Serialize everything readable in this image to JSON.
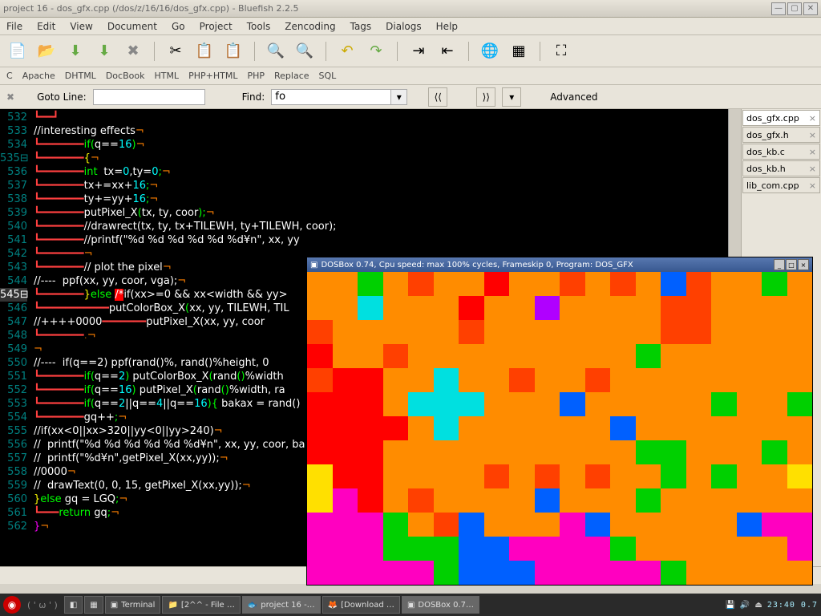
{
  "title": "project 16 - dos_gfx.cpp (/dos/z/16/16/dos_gfx.cpp) - Bluefish 2.2.5",
  "menu": [
    "File",
    "Edit",
    "View",
    "Document",
    "Go",
    "Project",
    "Tools",
    "Zencoding",
    "Tags",
    "Dialogs",
    "Help"
  ],
  "lang": [
    "C",
    "Apache",
    "DHTML",
    "DocBook",
    "HTML",
    "PHP+HTML",
    "PHP",
    "Replace",
    "SQL"
  ],
  "goto_label": "Goto Line:",
  "find_label": "Find:",
  "find_value": "fo",
  "advanced": "Advanced",
  "tabs": [
    {
      "label": "dos_gfx.cpp",
      "active": true
    },
    {
      "label": "dos_gfx.h",
      "active": false
    },
    {
      "label": "dos_kb.c",
      "active": false
    },
    {
      "label": "dos_kb.h",
      "active": false
    },
    {
      "label": "lib_com.cpp",
      "active": false
    }
  ],
  "lines": [
    532,
    533,
    534,
    535,
    536,
    537,
    538,
    539,
    540,
    541,
    542,
    543,
    544,
    545,
    546,
    547,
    548,
    549,
    550,
    551,
    552,
    553,
    554,
    555,
    556,
    557,
    558,
    559,
    560,
    561,
    562
  ],
  "highlight_line": 545,
  "dosbox_title": "DOSBox 0.74, Cpu speed: max 100% cycles, Frameskip  0, Program:   DOS_GFX",
  "taskbar": {
    "face": "( ' ω ' )",
    "items": [
      "Terminal",
      "[2^^ - File …",
      "project 16 -…",
      "[Download …",
      "DOSBox 0.7…"
    ],
    "clock": "23:40  0.7"
  },
  "pixel_colors": [
    "#ff8c00",
    "#ff8c00",
    "#00d000",
    "#ff8c00",
    "#ff4000",
    "#ff8c00",
    "#ff8c00",
    "#ff0000",
    "#ff8c00",
    "#ff8c00",
    "#ff4000",
    "#ff8c00",
    "#ff4000",
    "#ff8c00",
    "#0060ff",
    "#ff4000",
    "#ff8c00",
    "#ff8c00",
    "#00d000",
    "#ff8c00",
    "#ff8c00",
    "#ff8c00",
    "#00e0e0",
    "#ff8c00",
    "#ff8c00",
    "#ff8c00",
    "#ff0000",
    "#ff8c00",
    "#ff8c00",
    "#b000ff",
    "#ff8c00",
    "#ff8c00",
    "#ff8c00",
    "#ff8c00",
    "#ff4000",
    "#ff4000",
    "#ff8c00",
    "#ff8c00",
    "#ff8c00",
    "#ff8c00",
    "#ff4000",
    "#ff8c00",
    "#ff8c00",
    "#ff8c00",
    "#ff8c00",
    "#ff8c00",
    "#ff4000",
    "#ff8c00",
    "#ff8c00",
    "#ff8c00",
    "#ff8c00",
    "#ff8c00",
    "#ff8c00",
    "#ff8c00",
    "#ff4000",
    "#ff4000",
    "#ff8c00",
    "#ff8c00",
    "#ff8c00",
    "#ff8c00",
    "#ff0000",
    "#ff8c00",
    "#ff8c00",
    "#ff4000",
    "#ff8c00",
    "#ff8c00",
    "#ff8c00",
    "#ff8c00",
    "#ff8c00",
    "#ff8c00",
    "#ff8c00",
    "#ff8c00",
    "#ff8c00",
    "#00d000",
    "#ff8c00",
    "#ff8c00",
    "#ff8c00",
    "#ff8c00",
    "#ff8c00",
    "#ff8c00",
    "#ff4000",
    "#ff0000",
    "#ff0000",
    "#ff8c00",
    "#ff8c00",
    "#00e0e0",
    "#ff8c00",
    "#ff8c00",
    "#ff4000",
    "#ff8c00",
    "#ff8c00",
    "#ff4000",
    "#ff8c00",
    "#ff8c00",
    "#ff8c00",
    "#ff8c00",
    "#ff8c00",
    "#ff8c00",
    "#ff8c00",
    "#ff8c00",
    "#ff0000",
    "#ff0000",
    "#ff0000",
    "#ff8c00",
    "#00e0e0",
    "#00e0e0",
    "#00e0e0",
    "#ff8c00",
    "#ff8c00",
    "#ff8c00",
    "#0060ff",
    "#ff8c00",
    "#ff8c00",
    "#ff8c00",
    "#ff8c00",
    "#ff8c00",
    "#00d000",
    "#ff8c00",
    "#ff8c00",
    "#00d000",
    "#ff0000",
    "#ff0000",
    "#ff0000",
    "#ff0000",
    "#ff8c00",
    "#00e0e0",
    "#ff8c00",
    "#ff8c00",
    "#ff8c00",
    "#ff8c00",
    "#ff8c00",
    "#ff8c00",
    "#0060ff",
    "#ff8c00",
    "#ff8c00",
    "#ff8c00",
    "#ff8c00",
    "#ff8c00",
    "#ff8c00",
    "#ff8c00",
    "#ff0000",
    "#ff0000",
    "#ff0000",
    "#ff8c00",
    "#ff8c00",
    "#ff8c00",
    "#ff8c00",
    "#ff8c00",
    "#ff8c00",
    "#ff8c00",
    "#ff8c00",
    "#ff8c00",
    "#ff8c00",
    "#00d000",
    "#00d000",
    "#ff8c00",
    "#ff8c00",
    "#ff8c00",
    "#00d000",
    "#ff8c00",
    "#ffe000",
    "#ff0000",
    "#ff0000",
    "#ff8c00",
    "#ff8c00",
    "#ff8c00",
    "#ff8c00",
    "#ff4000",
    "#ff8c00",
    "#ff4000",
    "#ff8c00",
    "#ff4000",
    "#ff8c00",
    "#ff8c00",
    "#00d000",
    "#ff8c00",
    "#00d000",
    "#ff8c00",
    "#ff8c00",
    "#ffe000",
    "#ffe000",
    "#ff00c0",
    "#ff0000",
    "#ff8c00",
    "#ff4000",
    "#ff8c00",
    "#ff8c00",
    "#ff8c00",
    "#ff8c00",
    "#0060ff",
    "#ff8c00",
    "#ff8c00",
    "#ff8c00",
    "#00d000",
    "#ff8c00",
    "#ff8c00",
    "#ff8c00",
    "#ff8c00",
    "#ff8c00",
    "#ff8c00",
    "#ff00c0",
    "#ff00c0",
    "#ff00c0",
    "#00d000",
    "#ff8c00",
    "#ff4000",
    "#0060ff",
    "#ff8c00",
    "#ff8c00",
    "#ff8c00",
    "#ff00c0",
    "#0060ff",
    "#ff8c00",
    "#ff8c00",
    "#ff8c00",
    "#ff8c00",
    "#ff8c00",
    "#0060ff",
    "#ff00c0",
    "#ff00c0",
    "#ff00c0",
    "#ff00c0",
    "#ff00c0",
    "#00d000",
    "#00d000",
    "#00d000",
    "#0060ff",
    "#0060ff",
    "#ff00c0",
    "#ff00c0",
    "#ff00c0",
    "#ff00c0",
    "#00d000",
    "#ff8c00",
    "#ff8c00",
    "#ff8c00",
    "#ff8c00",
    "#ff8c00",
    "#ff8c00",
    "#ff00c0",
    "#ff00c0",
    "#ff00c0",
    "#ff00c0",
    "#ff00c0",
    "#ff00c0",
    "#00d000",
    "#0060ff",
    "#0060ff",
    "#0060ff",
    "#ff00c0",
    "#ff00c0",
    "#ff00c0",
    "#ff00c0",
    "#ff00c0",
    "#00d000",
    "#ff8c00",
    "#ff8c00",
    "#ff8c00",
    "#ff8c00",
    "#ff8c00"
  ]
}
